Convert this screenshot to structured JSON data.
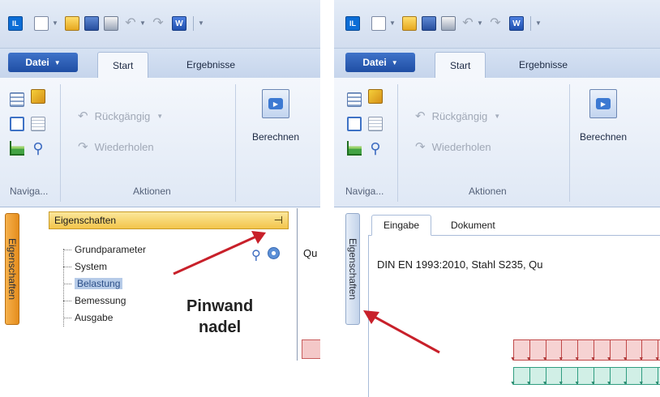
{
  "left": {
    "quick_access": {
      "app_icon_text": "IL",
      "word_icon_text": "W"
    },
    "tabs": {
      "file": "Datei",
      "start": "Start",
      "results": "Ergebnisse"
    },
    "ribbon": {
      "undo": "Rückgängig",
      "redo": "Wiederholen",
      "calculate": "Berechnen",
      "group_navigation": "Naviga...",
      "group_actions": "Aktionen"
    },
    "vertical_tab": "Eigenschaften",
    "properties": {
      "header": "Eigenschaften",
      "items": [
        "Grundparameter",
        "System",
        "Belastung",
        "Bemessung",
        "Ausgabe"
      ],
      "selected_index": 2
    },
    "truncated_text": "Qu",
    "annotation": {
      "line1": "Pinwand",
      "line2": "nadel"
    }
  },
  "right": {
    "quick_access": {
      "app_icon_text": "IL",
      "word_icon_text": "W"
    },
    "tabs": {
      "file": "Datei",
      "start": "Start",
      "results": "Ergebnisse"
    },
    "ribbon": {
      "undo": "Rückgängig",
      "redo": "Wiederholen",
      "calculate": "Berechnen",
      "group_navigation": "Naviga...",
      "group_actions": "Aktionen"
    },
    "vertical_tab": "Eigenschaften",
    "doc_tabs": {
      "input": "Eingabe",
      "document": "Dokument"
    },
    "doc_text": "DIN EN 1993:2010, Stahl S235, Qu"
  },
  "colors": {
    "file_tab": "#2a5cb3",
    "properties_header": "#f5cd5a",
    "vertical_tab_active": "#f0a235",
    "arrow": "#c8202a",
    "load_red": "#c04848",
    "load_teal": "#2f9d80"
  }
}
